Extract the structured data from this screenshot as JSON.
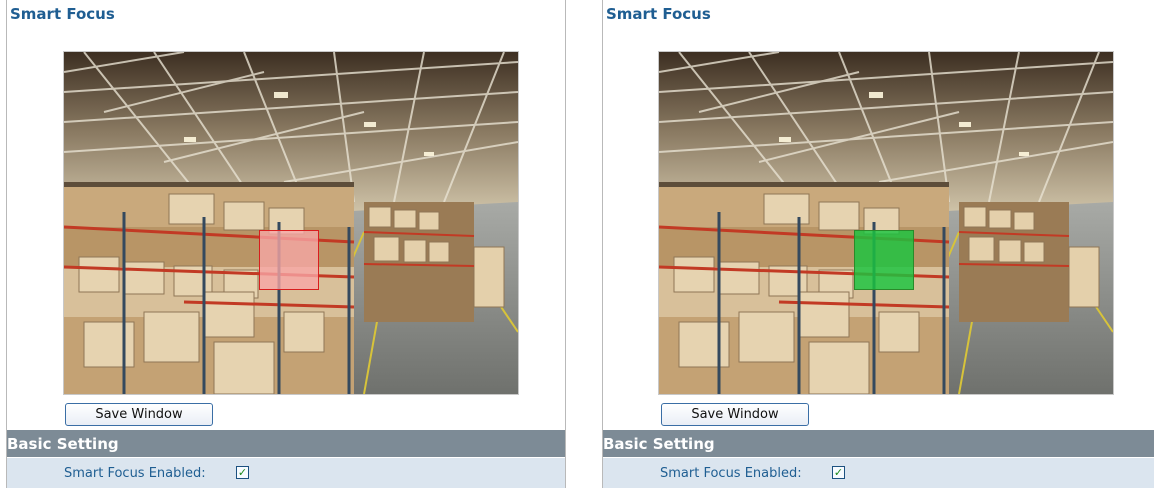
{
  "panels": [
    {
      "title": "Smart Focus",
      "save_button": "Save Window",
      "section_title": "Basic Setting",
      "setting_label": "Smart Focus Enabled:",
      "checkbox_mark": "✓",
      "focus_window_state": "unsaved",
      "focus_window_color": "#f8a6a6"
    },
    {
      "title": "Smart Focus",
      "save_button": "Save Window",
      "section_title": "Basic Setting",
      "setting_label": "Smart Focus Enabled:",
      "checkbox_mark": "✓",
      "focus_window_state": "saved",
      "focus_window_color": "#1ac440"
    }
  ],
  "colors": {
    "title_blue": "#1f5e92",
    "section_header_bg": "#7d8b96",
    "setting_row_bg": "#dbe5ef"
  },
  "smart_focus_enabled": true
}
